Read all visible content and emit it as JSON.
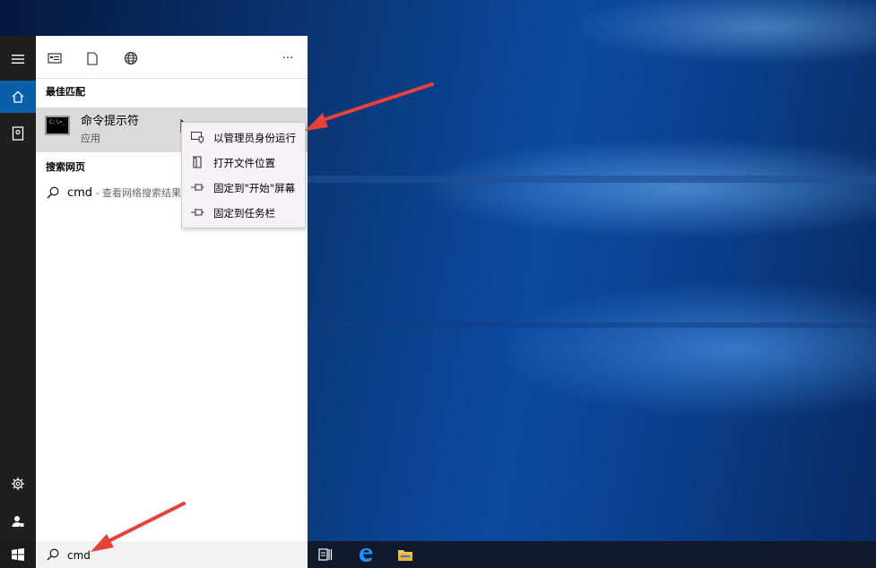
{
  "search_panel": {
    "sections": {
      "best_match": "最佳匹配",
      "web": "搜索网页"
    },
    "best_match_item": {
      "title": "命令提示符",
      "subtitle": "应用",
      "icon_text": "C:\\>_"
    },
    "web_result": {
      "query": "cmd",
      "suffix": " - 查看网络搜索结果"
    },
    "more_label": "···"
  },
  "context_menu": {
    "items": [
      {
        "label": "以管理员身份运行",
        "icon": "shield-run-icon"
      },
      {
        "label": "打开文件位置",
        "icon": "folder-open-icon"
      },
      {
        "label": "固定到\"开始\"屏幕",
        "icon": "pin-icon"
      },
      {
        "label": "固定到任务栏",
        "icon": "pin-icon"
      }
    ]
  },
  "search_box": {
    "value": "cmd"
  },
  "colors": {
    "accent": "#0b5ea8",
    "arrow": "#e8413a",
    "highlight": "#dadada"
  }
}
